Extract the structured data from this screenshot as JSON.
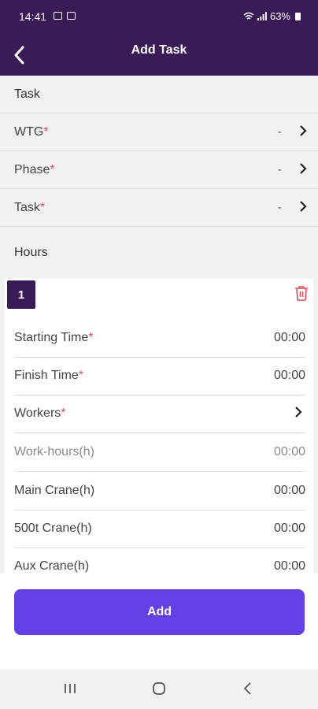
{
  "status_bar": {
    "time": "14:41",
    "battery": "63%"
  },
  "app_bar": {
    "title": "Add Task"
  },
  "task_section": {
    "header": "Task",
    "rows": [
      {
        "label": "WTG",
        "required_mark": "*",
        "value": "-"
      },
      {
        "label": "Phase",
        "required_mark": "*",
        "value": "-"
      },
      {
        "label": "Task",
        "required_mark": "*",
        "value": "-"
      }
    ]
  },
  "hours_section": {
    "header": "Hours",
    "entry": {
      "number": "1",
      "rows": [
        {
          "label": "Starting Time",
          "required_mark": "*",
          "value": "00:00"
        },
        {
          "label": "Finish Time",
          "required_mark": "*",
          "value": "00:00"
        },
        {
          "label": "Workers",
          "required_mark": "*",
          "value": ""
        },
        {
          "label": "Work-hours(h)",
          "required_mark": "",
          "value": "00:00"
        },
        {
          "label": "Main Crane(h)",
          "required_mark": "",
          "value": "00:00"
        },
        {
          "label": "500t Crane(h)",
          "required_mark": "",
          "value": "00:00"
        },
        {
          "label": "Aux Crane(h)",
          "required_mark": "",
          "value": "00:00"
        }
      ]
    }
  },
  "footer": {
    "add_label": "Add"
  },
  "colors": {
    "primary": "#3b1a58",
    "accent": "#6340e6",
    "required": "#e74c5b"
  }
}
